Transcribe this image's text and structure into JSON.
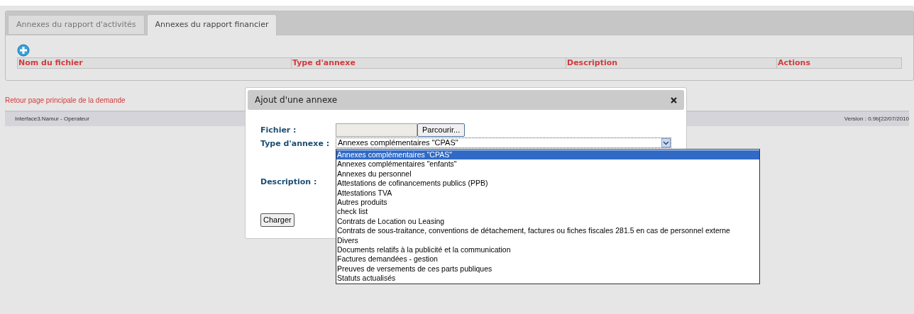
{
  "tabs": [
    {
      "label": "Annexes du rapport d'activités",
      "selected": false
    },
    {
      "label": "Annexes du rapport financier",
      "selected": true
    }
  ],
  "table": {
    "columns": [
      "Nom du fichier",
      "Type d'annexe",
      "Description",
      "Actions"
    ]
  },
  "back_link": "Retour page principale de la demande",
  "footer": {
    "left": "Interface3.Namur - Operateur",
    "right": "Version : 0.9b[22/07/2010"
  },
  "dialog": {
    "title": "Ajout d'une annexe",
    "file_label": "Fichier :",
    "browse_button": "Parcourir...",
    "type_label": "Type d'annexe :",
    "type_value": "Annexes complémentaires \"CPAS\"",
    "description_label": "Description :",
    "submit_button": "Charger",
    "options": [
      {
        "label": "Annexes complémentaires \"CPAS\"",
        "selected": true
      },
      {
        "label": "Annexes complémentaires \"enfants\"",
        "selected": false
      },
      {
        "label": "Annexes du personnel",
        "selected": false
      },
      {
        "label": "Attestations de cofinancements publics (PPB)",
        "selected": false
      },
      {
        "label": "Attestations TVA",
        "selected": false
      },
      {
        "label": "Autres produits",
        "selected": false
      },
      {
        "label": "check list",
        "selected": false
      },
      {
        "label": "Contrats de Location ou Leasing",
        "selected": false
      },
      {
        "label": "Contrats de sous-traitance, conventions de détachement, factures ou fiches fiscales 281.5 en cas de personnel externe",
        "selected": false
      },
      {
        "label": "Divers",
        "selected": false
      },
      {
        "label": "Documents relatifs à la publicité et la communication",
        "selected": false
      },
      {
        "label": "Factures demandées - gestion",
        "selected": false
      },
      {
        "label": "Preuves de versements de ces parts publiques",
        "selected": false
      },
      {
        "label": "Statuts actualisés",
        "selected": false
      }
    ]
  }
}
